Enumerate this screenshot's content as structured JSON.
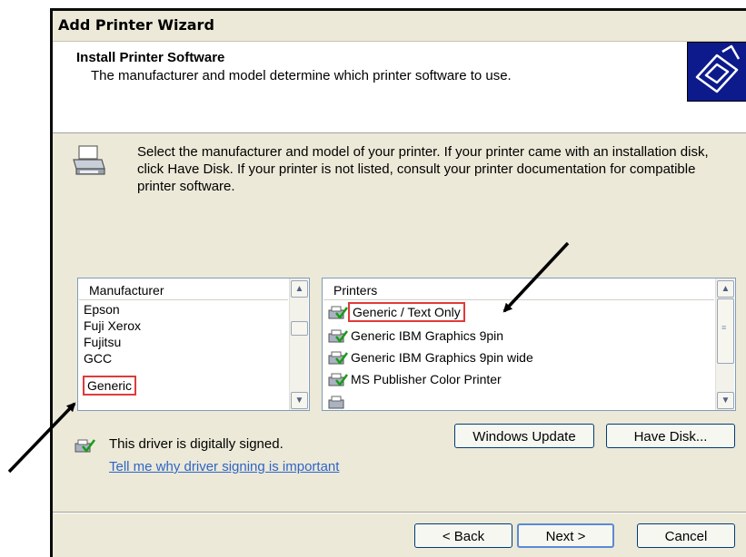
{
  "window": {
    "title": "Add Printer Wizard"
  },
  "header": {
    "title": "Install Printer Software",
    "subtitle": "The manufacturer and model determine which printer software to use."
  },
  "intro": "Select the manufacturer and model of your printer. If your printer came with an installation disk, click Have Disk. If your printer is not listed, consult your printer documentation for compatible printer software.",
  "manufacturer_list": {
    "header": "Manufacturer",
    "items": [
      "Epson",
      "Fuji Xerox",
      "Fujitsu",
      "GCC",
      "Generic"
    ],
    "selected": "Generic"
  },
  "printer_list": {
    "header": "Printers",
    "items": [
      "Generic / Text Only",
      "Generic IBM Graphics 9pin",
      "Generic IBM Graphics 9pin wide",
      "MS Publisher Color Printer"
    ],
    "selected": "Generic / Text Only"
  },
  "signing": {
    "status": "This driver is digitally signed.",
    "link": "Tell me why driver signing is important"
  },
  "buttons": {
    "windows_update": "Windows Update",
    "have_disk": "Have Disk...",
    "back": "< Back",
    "next": "Next >",
    "cancel": "Cancel"
  },
  "colors": {
    "dialog_bg": "#ece9d8",
    "highlight_box": "#e03a3a",
    "link": "#2e65c8",
    "header_icon_bg": "#0c1a8c"
  }
}
